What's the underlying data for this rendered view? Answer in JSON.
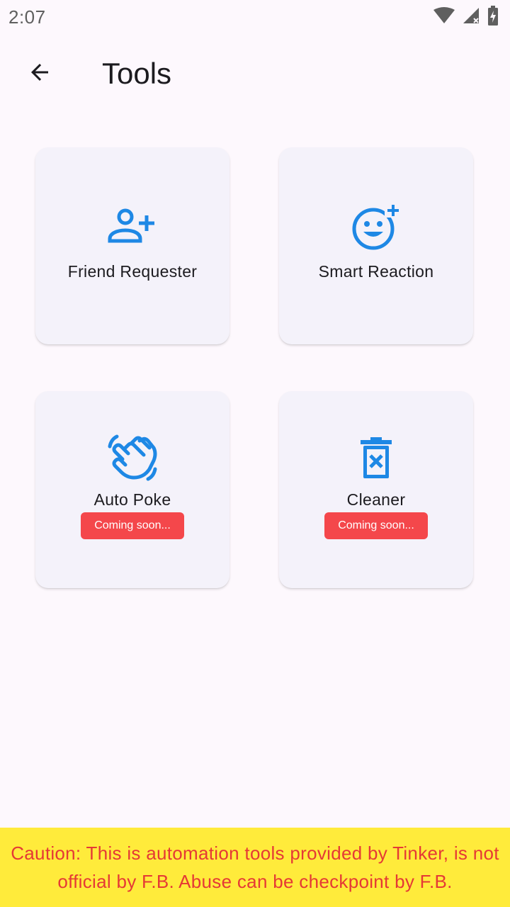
{
  "status_bar": {
    "time": "2:07",
    "icons": [
      "wifi-icon",
      "cell-signal-icon",
      "battery-icon"
    ]
  },
  "app_bar": {
    "back_icon": "arrow-back-icon",
    "title": "Tools"
  },
  "tools": [
    {
      "label": "Friend Requester",
      "icon": "person-add-icon",
      "badge": ""
    },
    {
      "label": "Smart Reaction",
      "icon": "emoji-add-icon",
      "badge": ""
    },
    {
      "label": "Auto Poke",
      "icon": "waving-hand-icon",
      "badge": "Coming soon..."
    },
    {
      "label": "Cleaner",
      "icon": "delete-forever-icon",
      "badge": "Coming soon..."
    }
  ],
  "caution": {
    "text": "Caution: This is automation tools provided by Tinker, is not official by F.B. Abuse can be checkpoint by F.B."
  },
  "colors": {
    "accent_blue": "#1e88e5",
    "badge_red": "#f4474b",
    "caution_bg": "#ffeb3b",
    "caution_text": "#e53935",
    "card_bg": "#f4f2fa",
    "page_bg": "#fdf8fd"
  }
}
